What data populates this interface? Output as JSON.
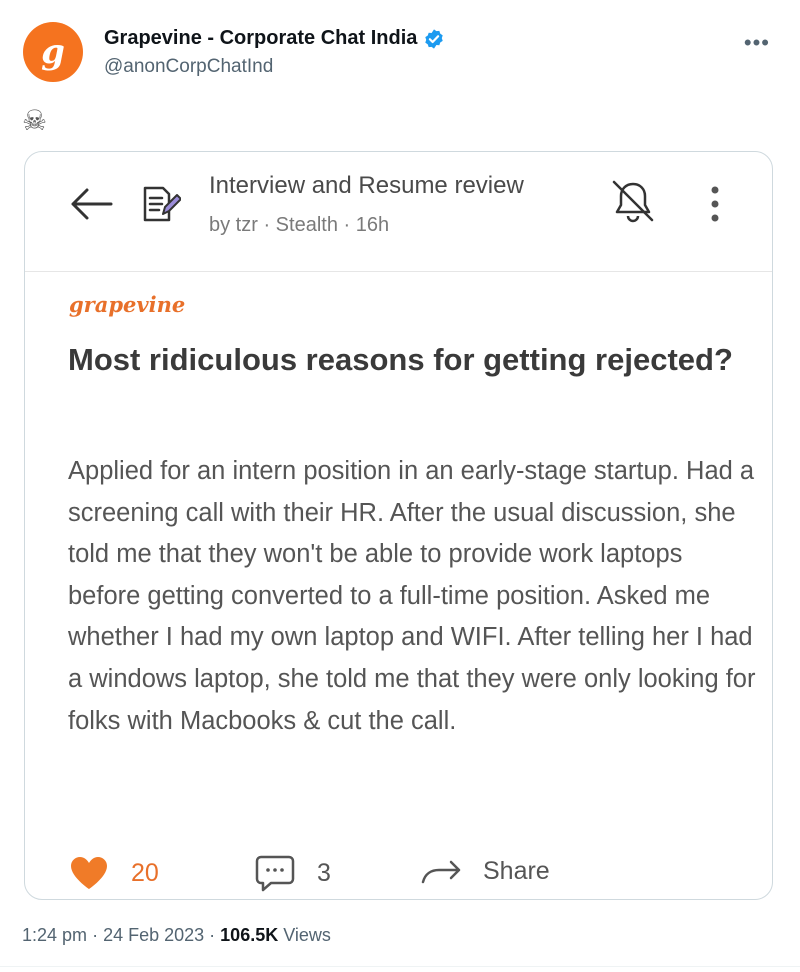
{
  "tweet": {
    "avatar_letter": "g",
    "author_name": "Grapevine - Corporate Chat India",
    "handle": "@anonCorpChatInd",
    "emoji": "☠",
    "more_icon": "more-horizontal-icon",
    "time": "1:24 pm",
    "date": "24 Feb 2023",
    "views_count": "106.5K",
    "views_label": "Views"
  },
  "card": {
    "post_title": "Interview and Resume review",
    "meta": "by tzr · Stealth · 16h",
    "brand": "grapevine",
    "headline": "Most ridiculous reasons for getting rejected?",
    "body": "Applied for an intern position in an early-stage startup. Had a screening call with their HR. After the usual discussion, she told me that they won't be able to provide work laptops before getting converted to a full-time position. Asked me whether I had my own laptop and WIFI. After telling her I had a windows laptop, she told me that they were only looking for folks with Macbooks & cut the call.",
    "likes": "20",
    "comments": "3",
    "share_label": "Share"
  },
  "colors": {
    "brand_orange": "#e8702a",
    "verified_blue": "#1d9bf0"
  }
}
